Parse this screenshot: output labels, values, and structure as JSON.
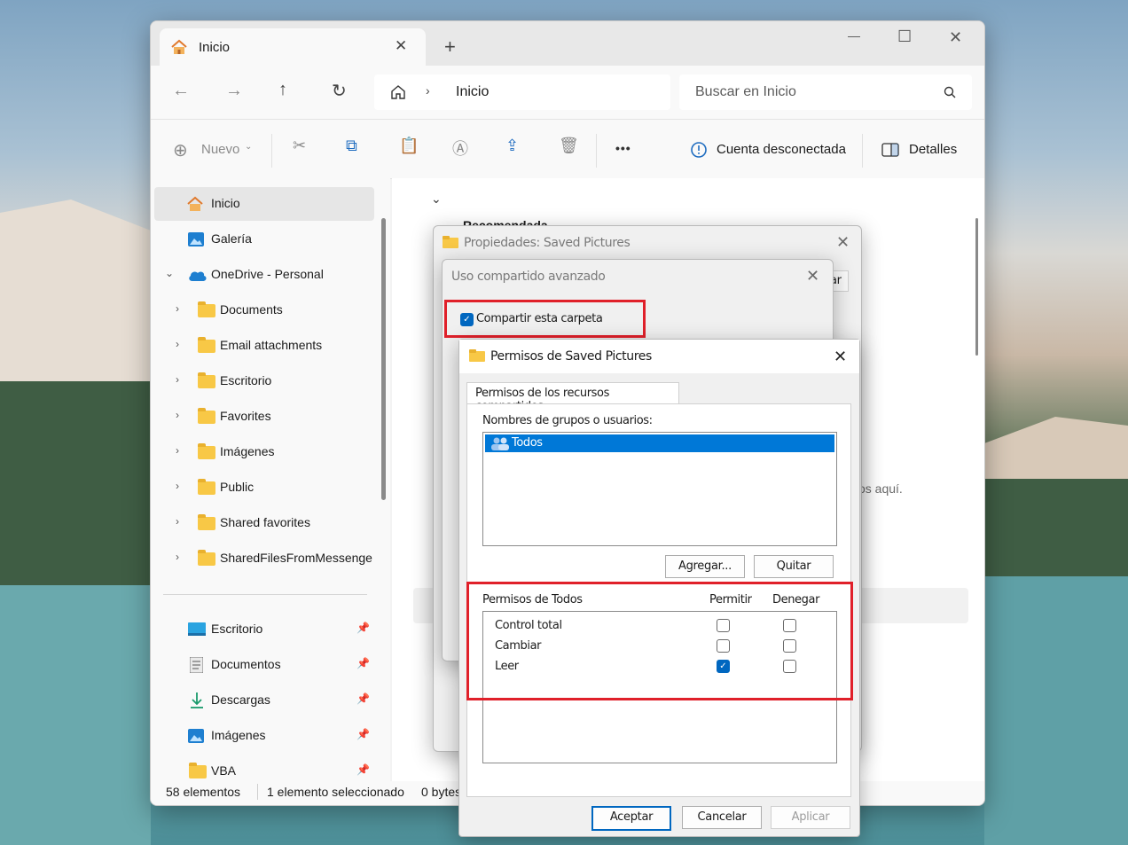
{
  "window": {
    "tab_title": "Inicio",
    "new_tab": "+",
    "minimize": "—",
    "maximize": "☐",
    "close": "✕"
  },
  "nav": {
    "breadcrumb": "Inicio",
    "search_placeholder": "Buscar en Inicio"
  },
  "toolbar": {
    "new_label": "Nuevo",
    "more": "•••",
    "account_status": "Cuenta desconectada",
    "details_label": "Detalles"
  },
  "sidebar": {
    "items": [
      {
        "label": "Inicio",
        "icon": "home-icon",
        "selected": true
      },
      {
        "label": "Galería",
        "icon": "gallery-icon"
      },
      {
        "label": "OneDrive - Personal",
        "icon": "onedrive-cloud-icon",
        "expanded": true
      },
      {
        "label": "Documents",
        "icon": "folder-icon"
      },
      {
        "label": "Email attachments",
        "icon": "folder-icon"
      },
      {
        "label": "Escritorio",
        "icon": "folder-icon"
      },
      {
        "label": "Favorites",
        "icon": "folder-icon"
      },
      {
        "label": "Imágenes",
        "icon": "folder-icon"
      },
      {
        "label": "Public",
        "icon": "folder-icon"
      },
      {
        "label": "Shared favorites",
        "icon": "folder-icon"
      },
      {
        "label": "SharedFilesFromMessenge",
        "icon": "folder-icon"
      }
    ],
    "pinned": [
      {
        "label": "Escritorio",
        "icon": "desktop-icon"
      },
      {
        "label": "Documentos",
        "icon": "documents-icon"
      },
      {
        "label": "Descargas",
        "icon": "download-icon"
      },
      {
        "label": "Imágenes",
        "icon": "pictures-icon"
      },
      {
        "label": "VBA",
        "icon": "folder-icon"
      }
    ]
  },
  "content": {
    "section_title": "Recomendada",
    "partial_text": "os aquí."
  },
  "status": {
    "items_count": "58 elementos",
    "selected": "1 elemento seleccionado",
    "size": "0 bytes"
  },
  "properties_dialog": {
    "title": "Propiedades: Saved Pictures",
    "partial_tab": "ar"
  },
  "advanced_sharing": {
    "title": "Uso compartido avanzado",
    "share_checkbox": "Compartir esta carpeta",
    "share_checked": true
  },
  "permissions_dialog": {
    "title": "Permisos de Saved Pictures",
    "tab": "Permisos de los recursos compartidos",
    "groups_label": "Nombres de grupos o usuarios:",
    "users": [
      "Todos"
    ],
    "add_button": "Agregar...",
    "remove_button": "Quitar",
    "perm_header": "Permisos de Todos",
    "allow_header": "Permitir",
    "deny_header": "Denegar",
    "permissions": [
      {
        "name": "Control total",
        "allow": false,
        "deny": false
      },
      {
        "name": "Cambiar",
        "allow": false,
        "deny": false
      },
      {
        "name": "Leer",
        "allow": true,
        "deny": false
      }
    ],
    "ok_button": "Aceptar",
    "cancel_button": "Cancelar",
    "apply_button": "Aplicar"
  },
  "colors": {
    "accent": "#0067c0",
    "highlight_box": "#e0202a",
    "selection": "#0078d7"
  }
}
